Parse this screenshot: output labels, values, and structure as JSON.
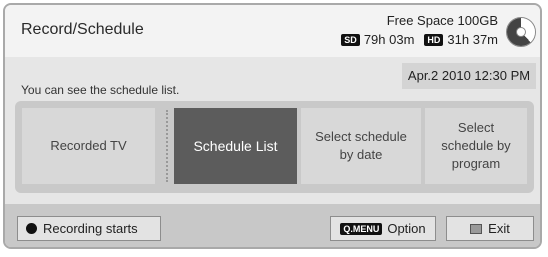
{
  "header": {
    "title": "Record/Schedule",
    "free_space": "Free Space 100GB",
    "sd_tag": "SD",
    "sd_time": "79h 03m",
    "hd_tag": "HD",
    "hd_time": "31h 37m",
    "disk_icon": "disk-usage-icon"
  },
  "datetime": "Apr.2 2010 12:30 PM",
  "info_text": "You can see the schedule list.",
  "menu": {
    "items": [
      {
        "label": "Recorded TV",
        "selected": false
      },
      {
        "label": "Schedule List",
        "selected": true
      },
      {
        "label": "Select schedule by date",
        "selected": false
      },
      {
        "label": "Select schedule by program",
        "selected": false
      }
    ]
  },
  "footer": {
    "record_label": "Recording starts",
    "qmenu_tag": "Q.MENU",
    "option_label": "Option",
    "exit_label": "Exit"
  },
  "colors": {
    "selected_bg": "#5c5c5c",
    "panel_bg": "#c9c9c9",
    "item_bg": "#d8d8d8"
  }
}
